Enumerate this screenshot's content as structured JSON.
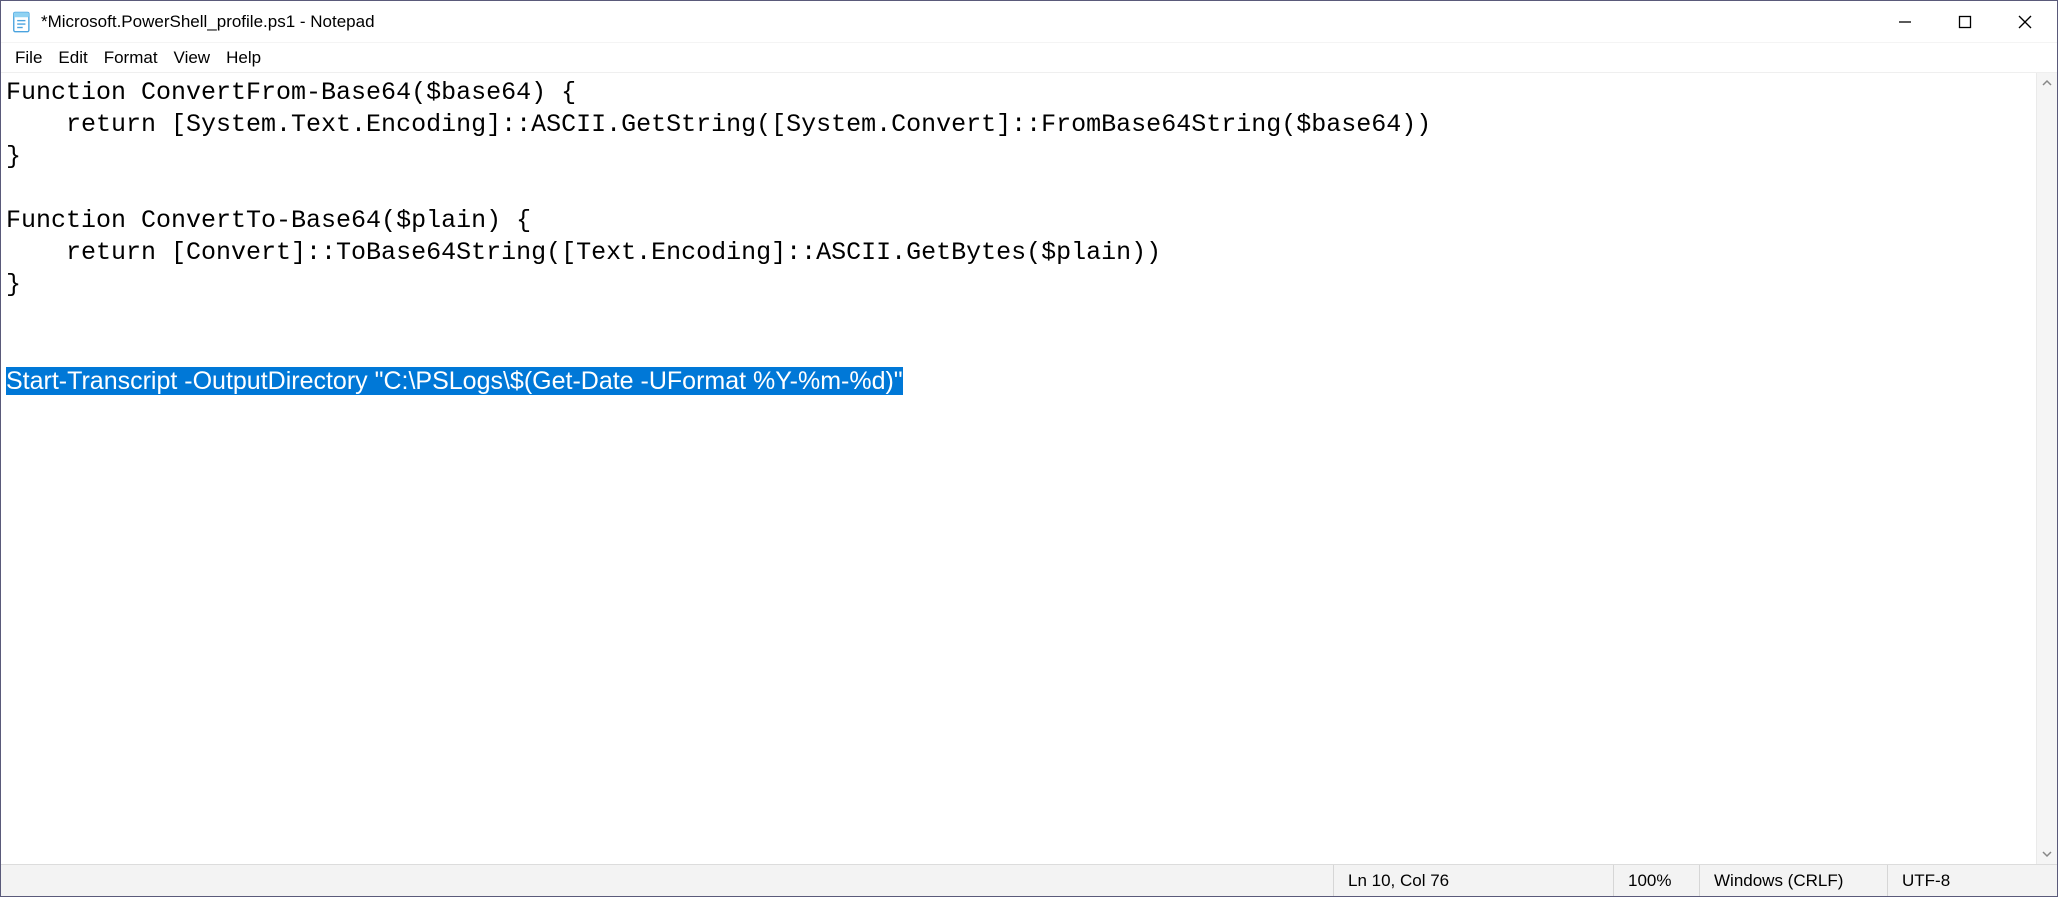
{
  "titlebar": {
    "title": "*Microsoft.PowerShell_profile.ps1 - Notepad"
  },
  "menubar": {
    "items": [
      "File",
      "Edit",
      "Format",
      "View",
      "Help"
    ]
  },
  "editor": {
    "lines": [
      "Function ConvertFrom-Base64($base64) {",
      "    return [System.Text.Encoding]::ASCII.GetString([System.Convert]::FromBase64String($base64))",
      "}",
      "",
      "Function ConvertTo-Base64($plain) {",
      "    return [Convert]::ToBase64String([Text.Encoding]::ASCII.GetBytes($plain))",
      "}",
      "",
      ""
    ],
    "selected_line": "Start-Transcript -OutputDirectory \"C:\\PSLogs\\$(Get-Date -UFormat %Y-%m-%d)\""
  },
  "statusbar": {
    "position": "Ln 10, Col 76",
    "zoom": "100%",
    "eol": "Windows (CRLF)",
    "encoding": "UTF-8"
  }
}
